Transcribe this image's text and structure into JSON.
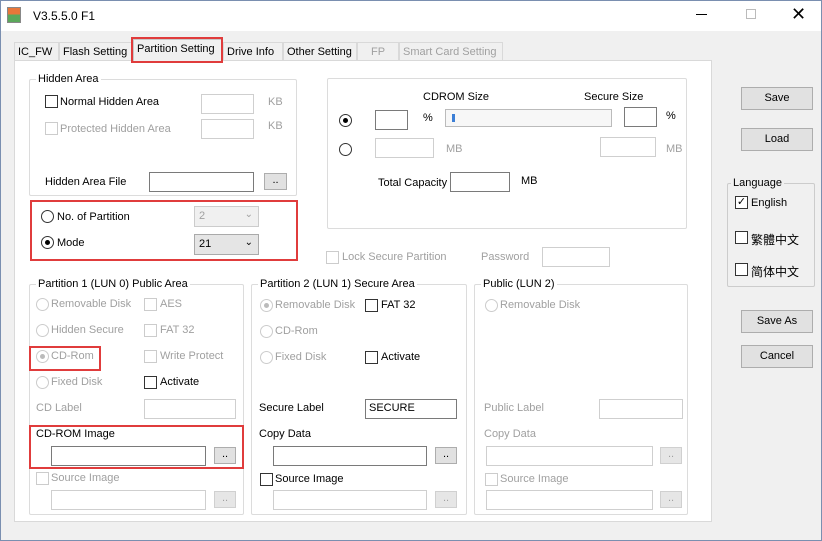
{
  "window": {
    "title": "V3.5.5.0 F1",
    "icon": "app-icon",
    "controls": [
      "minimize-icon",
      "maximize-icon",
      "close-icon"
    ]
  },
  "tabs": [
    {
      "label": "IC_FW"
    },
    {
      "label": "Flash Setting"
    },
    {
      "label": "Partition Setting",
      "selected": true
    },
    {
      "label": "Drive Info"
    },
    {
      "label": "Other Setting"
    },
    {
      "label": "FP",
      "disabled": true
    },
    {
      "label": "Smart Card Setting",
      "disabled": true
    }
  ],
  "hidden_area": {
    "title": "Hidden Area",
    "normal": "Normal Hidden Area",
    "protected": "Protected Hidden Area",
    "kb": "KB",
    "file_label": "Hidden Area File",
    "browse": ".."
  },
  "partition": {
    "no_label": "No. of Partition",
    "no_value": "2",
    "mode_label": "Mode",
    "mode_value": "21"
  },
  "size": {
    "cdrom_label": "CDROM Size",
    "secure_label": "Secure Size",
    "percent": "%",
    "mb": "MB",
    "total_label": "Total Capacity",
    "slider_value": 0
  },
  "lock": {
    "label": "Lock Secure Partition",
    "password_label": "Password"
  },
  "p1": {
    "title": "Partition 1 (LUN 0) Public Area",
    "removable": "Removable Disk",
    "aes": "AES",
    "hidden_secure": "Hidden Secure",
    "fat32": "FAT 32",
    "cdrom": "CD-Rom",
    "write_protect": "Write Protect",
    "fixed": "Fixed Disk",
    "activate": "Activate",
    "cd_label": "CD Label",
    "cdrom_image": "CD-ROM Image",
    "source_image": "Source Image",
    "browse": ".."
  },
  "p2": {
    "title": "Partition 2 (LUN 1) Secure Area",
    "removable": "Removable Disk",
    "fat32": "FAT 32",
    "cdrom": "CD-Rom",
    "fixed": "Fixed Disk",
    "activate": "Activate",
    "secure_label": "Secure Label",
    "secure_value": "SECURE",
    "copy_data": "Copy Data",
    "source_image": "Source Image",
    "browse": ".."
  },
  "p3": {
    "title": "Public (LUN 2)",
    "removable": "Removable Disk",
    "public_label": "Public Label",
    "copy_data": "Copy Data",
    "source_image": "Source Image",
    "browse": ".."
  },
  "buttons": {
    "save": "Save",
    "load": "Load",
    "save_as": "Save As",
    "cancel": "Cancel"
  },
  "language": {
    "title": "Language",
    "english": "English",
    "trad": "繁體中文",
    "simp": "简体中文"
  },
  "colors": {
    "highlight": "#e03c3c"
  }
}
